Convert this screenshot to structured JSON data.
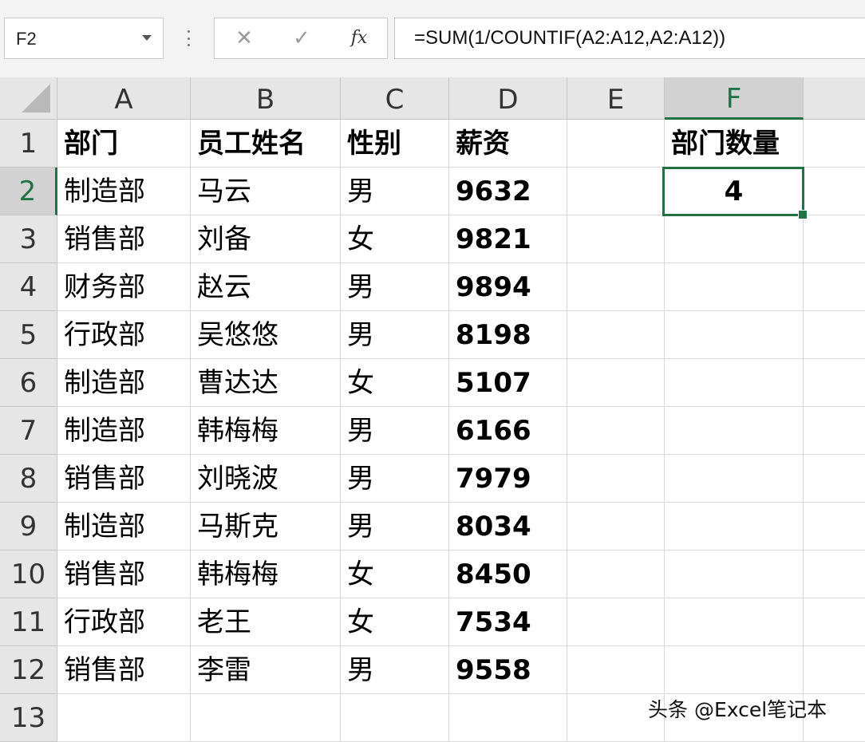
{
  "formula_bar": {
    "name_box": "F2",
    "cancel_symbol": "✕",
    "enter_symbol": "✓",
    "fx_label": "fx",
    "formula": "=SUM(1/COUNTIF(A2:A12,A2:A12))"
  },
  "columns": [
    "A",
    "B",
    "C",
    "D",
    "E",
    "F"
  ],
  "rows": [
    "1",
    "2",
    "3",
    "4",
    "5",
    "6",
    "7",
    "8",
    "9",
    "10",
    "11",
    "12",
    "13"
  ],
  "header_row": {
    "A": "部门",
    "B": "员工姓名",
    "C": "性别",
    "D": "薪资",
    "F": "部门数量"
  },
  "data_rows": [
    {
      "A": "制造部",
      "B": "马云",
      "C": "男",
      "D": "9632"
    },
    {
      "A": "销售部",
      "B": "刘备",
      "C": "女",
      "D": "9821"
    },
    {
      "A": "财务部",
      "B": "赵云",
      "C": "男",
      "D": "9894"
    },
    {
      "A": "行政部",
      "B": "吴悠悠",
      "C": "男",
      "D": "8198"
    },
    {
      "A": "制造部",
      "B": "曹达达",
      "C": "女",
      "D": "5107"
    },
    {
      "A": "制造部",
      "B": "韩梅梅",
      "C": "男",
      "D": "6166"
    },
    {
      "A": "销售部",
      "B": "刘晓波",
      "C": "男",
      "D": "7979"
    },
    {
      "A": "制造部",
      "B": "马斯克",
      "C": "男",
      "D": "8034"
    },
    {
      "A": "销售部",
      "B": "韩梅梅",
      "C": "女",
      "D": "8450"
    },
    {
      "A": "行政部",
      "B": "老王",
      "C": "女",
      "D": "7534"
    },
    {
      "A": "销售部",
      "B": "李雷",
      "C": "男",
      "D": "9558"
    }
  ],
  "result_cell": {
    "address": "F2",
    "value": "4"
  },
  "selection": {
    "column": "F",
    "row": "2"
  },
  "watermark": "头条 @Excel笔记本",
  "colors": {
    "accent": "#217346",
    "header_bg": "#e6e6e6",
    "gridline": "#d8d8d8"
  }
}
